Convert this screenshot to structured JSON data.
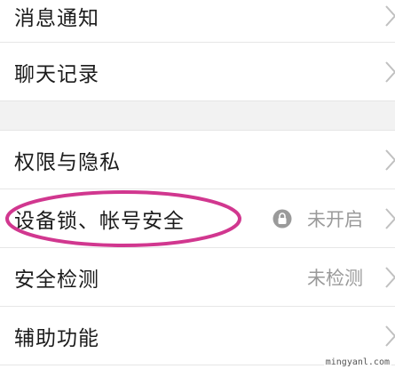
{
  "settings": {
    "notifications": {
      "label": "消息通知"
    },
    "chat_history": {
      "label": "聊天记录"
    },
    "privacy": {
      "label": "权限与隐私"
    },
    "device_lock": {
      "label": "设备锁、帐号安全",
      "status": "未开启"
    },
    "security_check": {
      "label": "安全检测",
      "status": "未检测"
    },
    "accessibility": {
      "label": "辅助功能"
    }
  },
  "colors": {
    "highlight": "#d1378f",
    "status_text": "#9a9a9a",
    "chevron": "#c0c0c0",
    "section_gap": "#f2f2f2"
  },
  "icons": [
    "lock-icon",
    "chevron-right-icon"
  ],
  "watermark": "mingyanl.com"
}
